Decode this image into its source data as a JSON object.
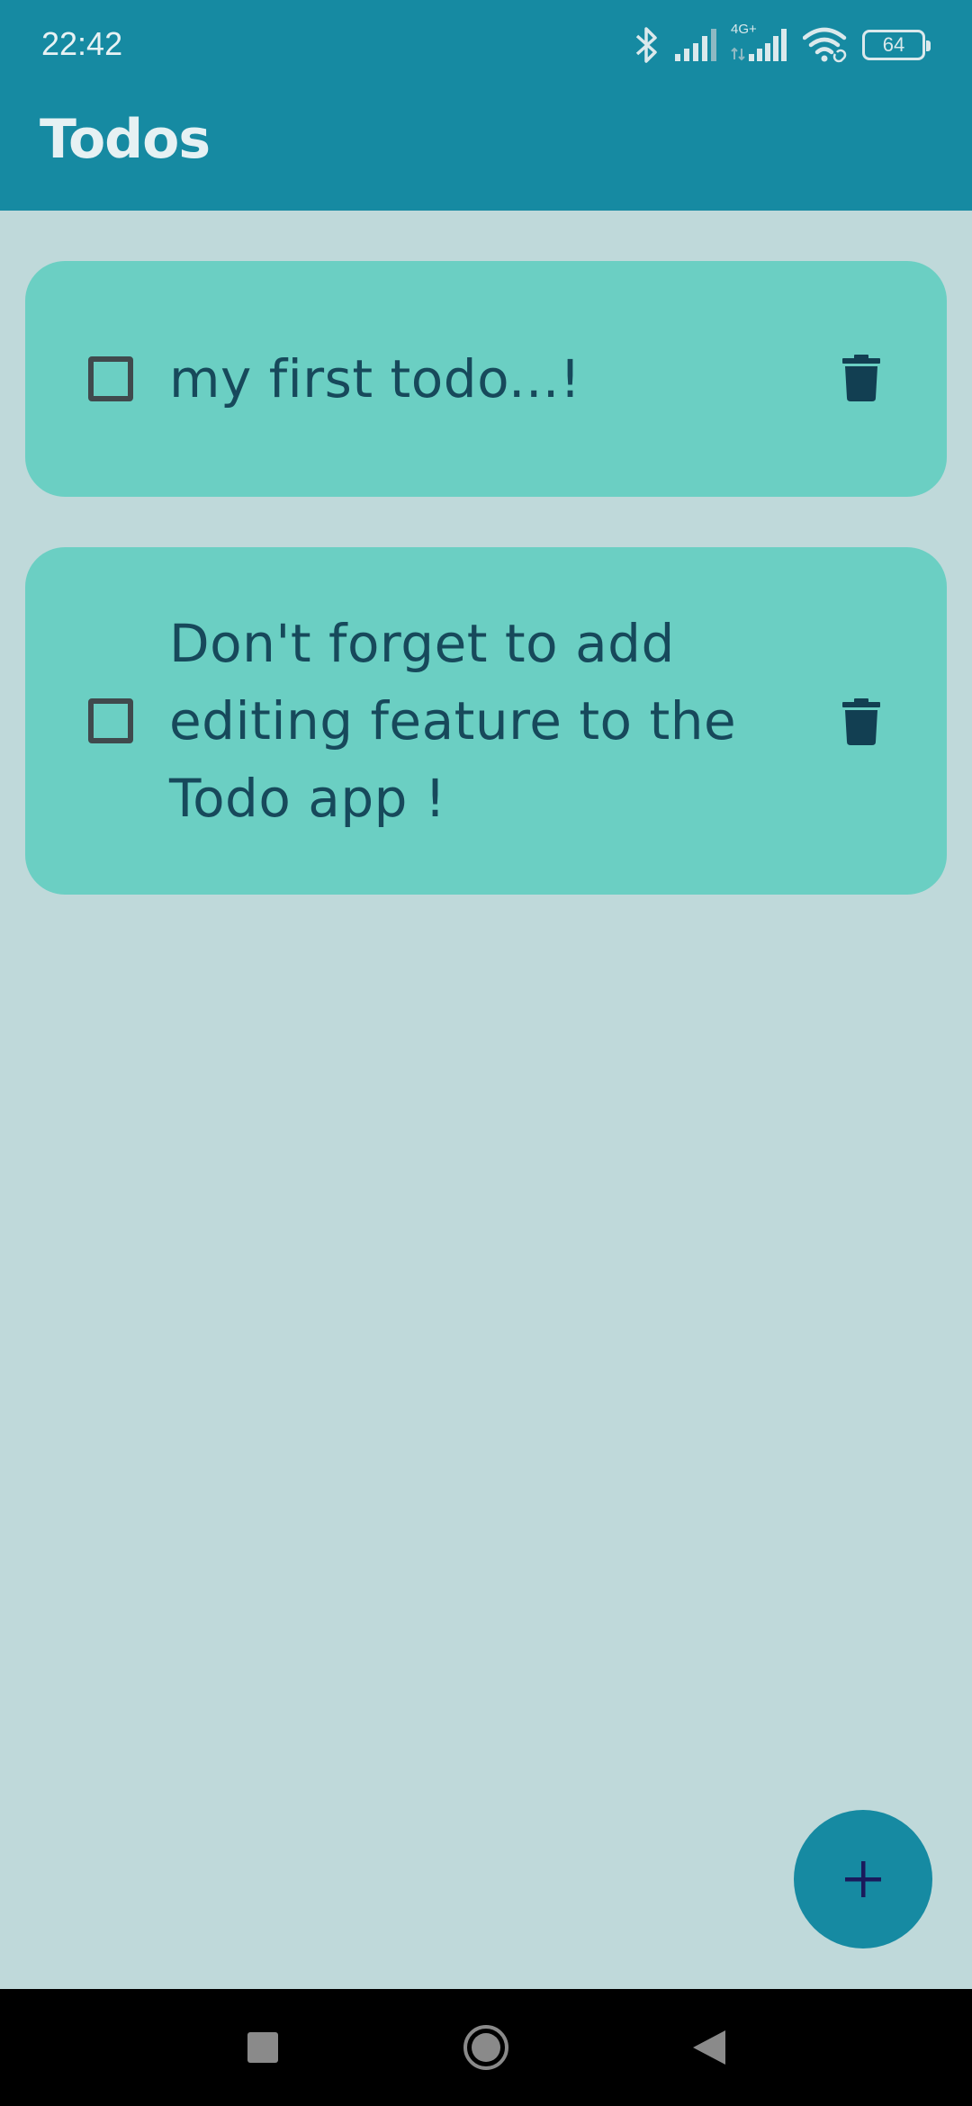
{
  "status_bar": {
    "time": "22:42",
    "network_label": "4G+",
    "battery_level": "64",
    "icons": [
      "bluetooth-icon",
      "signal-icon",
      "signal-4g-icon",
      "wifi-icon",
      "battery-icon"
    ]
  },
  "app_bar": {
    "title": "Todos"
  },
  "todos": [
    {
      "text": "my first todo...!",
      "checked": false
    },
    {
      "text": "Don't forget to add editing feature to the Todo app !",
      "checked": false
    }
  ],
  "fab": {
    "icon": "plus-icon"
  },
  "nav_bar": {
    "icons": [
      "recents-icon",
      "home-icon",
      "back-icon"
    ]
  },
  "colors": {
    "primary": "#168aa2",
    "background": "#bfd9da",
    "card": "#6bcfc3",
    "text": "#17495b",
    "fab_icon": "#1a1a5c"
  }
}
